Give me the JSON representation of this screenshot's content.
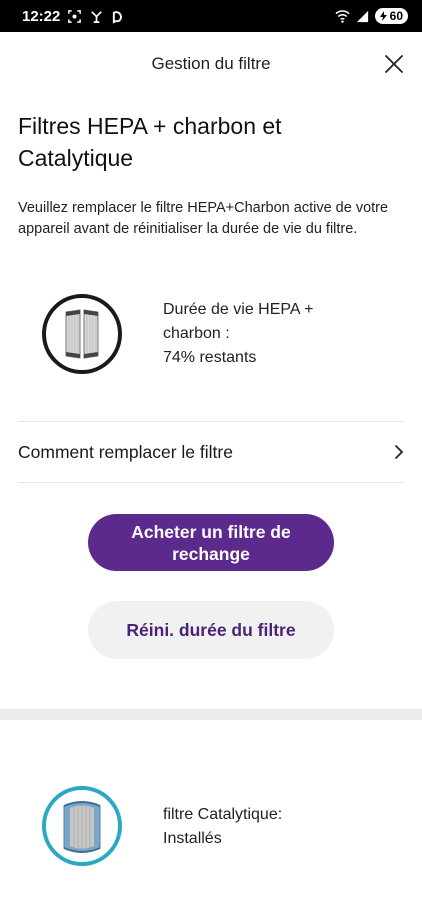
{
  "status_bar": {
    "time": "12:22",
    "battery": "60"
  },
  "header": {
    "title": "Gestion du filtre"
  },
  "hepa_section": {
    "title": "Filtres HEPA + charbon et Catalytique",
    "description": "Veuillez remplacer le filtre HEPA+Charbon active de votre appareil avant de réinitialiser la durée de vie du filtre.",
    "life_label_line1": "Durée de vie HEPA +",
    "life_label_line2": "charbon :",
    "life_remaining": "74% restants",
    "remaining_percent": 74
  },
  "howto": {
    "label": "Comment remplacer le filtre"
  },
  "buttons": {
    "buy_label": "Acheter un filtre de rechange",
    "reset_label": "Réini. durée du filtre"
  },
  "catalytic_section": {
    "label": "filtre Catalytique:",
    "status": "Installés"
  },
  "colors": {
    "primary": "#5b2a8c",
    "secondary_text": "#4b2377",
    "secondary_bg": "#f1f1f1",
    "ring": "#1a1a1a",
    "catalytic_ring": "#2ba8c4"
  }
}
